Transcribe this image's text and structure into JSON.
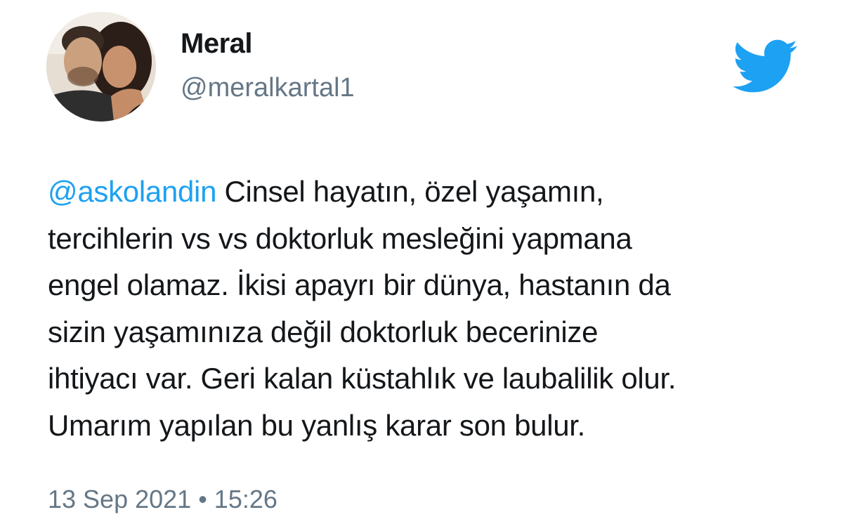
{
  "author": {
    "display_name": "Meral",
    "handle": "@meralkartal1",
    "avatar_icon": "profile-photo"
  },
  "brand": {
    "icon": "twitter-bird-icon",
    "color": "#1da1f2"
  },
  "tweet": {
    "mention": "@askolandin",
    "lines": [
      " Cinsel hayatın, özel yaşamın,",
      "tercihlerin vs vs doktorluk mesleğini yapmana",
      "engel olamaz. İkisi apayrı bir dünya, hastanın da",
      "sizin yaşamınıza değil doktorluk becerinize",
      "ihtiyacı var. Geri kalan küstahlık ve laubalilik olur.",
      "Umarım yapılan bu yanlış karar son bulur."
    ],
    "timestamp": "13 Sep 2021 • 15:26"
  },
  "colors": {
    "text": "#14171a",
    "secondary": "#657786",
    "link": "#1da1f2"
  }
}
